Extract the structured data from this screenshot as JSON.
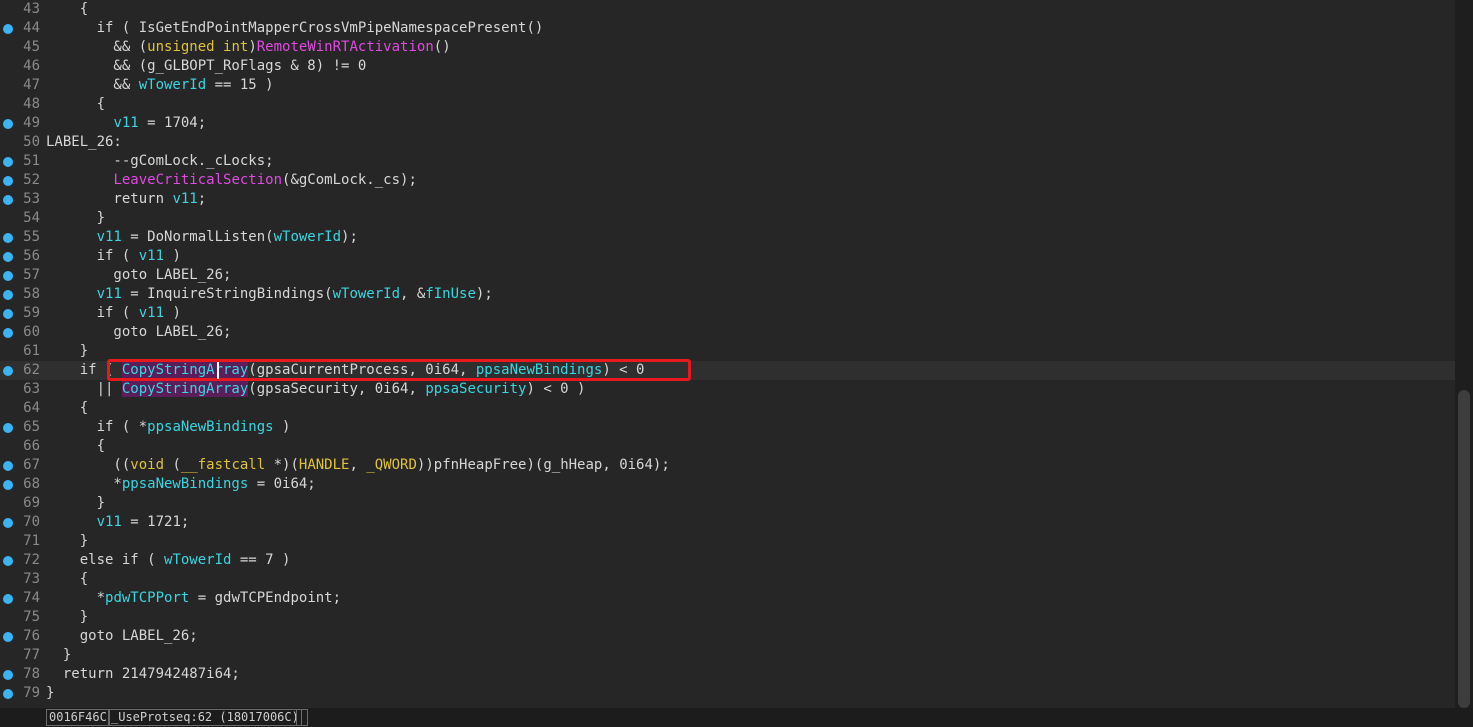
{
  "lines": [
    {
      "n": "43",
      "bp": false,
      "tokens": [
        {
          "t": "    {",
          "c": "plain"
        }
      ]
    },
    {
      "n": "44",
      "bp": true,
      "tokens": [
        {
          "t": "      if ( ",
          "c": "plain"
        },
        {
          "t": "IsGetEndPointMapperCrossVmPipeNamespacePresent",
          "c": "plain"
        },
        {
          "t": "()",
          "c": "plain"
        }
      ]
    },
    {
      "n": "45",
      "bp": false,
      "tokens": [
        {
          "t": "        && (",
          "c": "plain"
        },
        {
          "t": "unsigned int",
          "c": "type"
        },
        {
          "t": ")",
          "c": "plain"
        },
        {
          "t": "RemoteWinRTActivation",
          "c": "func"
        },
        {
          "t": "()",
          "c": "plain"
        }
      ]
    },
    {
      "n": "46",
      "bp": false,
      "tokens": [
        {
          "t": "        && (g_GLBOPT_RoFlags & 8) != 0",
          "c": "plain"
        }
      ]
    },
    {
      "n": "47",
      "bp": false,
      "tokens": [
        {
          "t": "        && ",
          "c": "plain"
        },
        {
          "t": "wTowerId",
          "c": "var"
        },
        {
          "t": " == 15 )",
          "c": "plain"
        }
      ]
    },
    {
      "n": "48",
      "bp": false,
      "tokens": [
        {
          "t": "      {",
          "c": "plain"
        }
      ]
    },
    {
      "n": "49",
      "bp": true,
      "tokens": [
        {
          "t": "        ",
          "c": "plain"
        },
        {
          "t": "v11",
          "c": "var"
        },
        {
          "t": " = 1704;",
          "c": "plain"
        }
      ]
    },
    {
      "n": "50",
      "bp": false,
      "tokens": [
        {
          "t": "LABEL_26:",
          "c": "plain"
        }
      ]
    },
    {
      "n": "51",
      "bp": true,
      "tokens": [
        {
          "t": "        --gComLock._cLocks;",
          "c": "plain"
        }
      ]
    },
    {
      "n": "52",
      "bp": true,
      "tokens": [
        {
          "t": "        ",
          "c": "plain"
        },
        {
          "t": "LeaveCriticalSection",
          "c": "func"
        },
        {
          "t": "(&gComLock._cs);",
          "c": "plain"
        }
      ]
    },
    {
      "n": "53",
      "bp": true,
      "tokens": [
        {
          "t": "        return ",
          "c": "plain"
        },
        {
          "t": "v11",
          "c": "var"
        },
        {
          "t": ";",
          "c": "plain"
        }
      ]
    },
    {
      "n": "54",
      "bp": false,
      "tokens": [
        {
          "t": "      }",
          "c": "plain"
        }
      ]
    },
    {
      "n": "55",
      "bp": true,
      "tokens": [
        {
          "t": "      ",
          "c": "plain"
        },
        {
          "t": "v11",
          "c": "var"
        },
        {
          "t": " = DoNormalListen(",
          "c": "plain"
        },
        {
          "t": "wTowerId",
          "c": "var"
        },
        {
          "t": ");",
          "c": "plain"
        }
      ]
    },
    {
      "n": "56",
      "bp": true,
      "tokens": [
        {
          "t": "      if ( ",
          "c": "plain"
        },
        {
          "t": "v11",
          "c": "var"
        },
        {
          "t": " )",
          "c": "plain"
        }
      ]
    },
    {
      "n": "57",
      "bp": true,
      "tokens": [
        {
          "t": "        goto LABEL_26;",
          "c": "plain"
        }
      ]
    },
    {
      "n": "58",
      "bp": true,
      "tokens": [
        {
          "t": "      ",
          "c": "plain"
        },
        {
          "t": "v11",
          "c": "var"
        },
        {
          "t": " = InquireStringBindings(",
          "c": "plain"
        },
        {
          "t": "wTowerId",
          "c": "var"
        },
        {
          "t": ", &",
          "c": "plain"
        },
        {
          "t": "fInUse",
          "c": "var"
        },
        {
          "t": ");",
          "c": "plain"
        }
      ]
    },
    {
      "n": "59",
      "bp": true,
      "tokens": [
        {
          "t": "      if ( ",
          "c": "plain"
        },
        {
          "t": "v11",
          "c": "var"
        },
        {
          "t": " )",
          "c": "plain"
        }
      ]
    },
    {
      "n": "60",
      "bp": true,
      "tokens": [
        {
          "t": "        goto LABEL_26;",
          "c": "plain"
        }
      ]
    },
    {
      "n": "61",
      "bp": false,
      "tokens": [
        {
          "t": "    }",
          "c": "plain"
        }
      ]
    },
    {
      "n": "62",
      "bp": true,
      "current": true,
      "tokens": [
        {
          "t": "    if ( ",
          "c": "plain"
        },
        {
          "t": "CopyStringArray",
          "c": "hl"
        },
        {
          "t": "(gpsaCurrentProcess, 0i64, ",
          "c": "plain"
        },
        {
          "t": "ppsaNewBindings",
          "c": "var"
        },
        {
          "t": ") < 0",
          "c": "plain"
        }
      ]
    },
    {
      "n": "63",
      "bp": false,
      "tokens": [
        {
          "t": "      || ",
          "c": "plain"
        },
        {
          "t": "CopyStringArray",
          "c": "hl"
        },
        {
          "t": "(gpsaSecurity, 0i64, ",
          "c": "plain"
        },
        {
          "t": "ppsaSecurity",
          "c": "var"
        },
        {
          "t": ") < 0 )",
          "c": "plain"
        }
      ]
    },
    {
      "n": "64",
      "bp": false,
      "tokens": [
        {
          "t": "    {",
          "c": "plain"
        }
      ]
    },
    {
      "n": "65",
      "bp": true,
      "tokens": [
        {
          "t": "      if ( *",
          "c": "plain"
        },
        {
          "t": "ppsaNewBindings",
          "c": "var"
        },
        {
          "t": " )",
          "c": "plain"
        }
      ]
    },
    {
      "n": "66",
      "bp": false,
      "tokens": [
        {
          "t": "      {",
          "c": "plain"
        }
      ]
    },
    {
      "n": "67",
      "bp": true,
      "tokens": [
        {
          "t": "        ((",
          "c": "plain"
        },
        {
          "t": "void",
          "c": "type"
        },
        {
          "t": " (",
          "c": "plain"
        },
        {
          "t": "__fastcall",
          "c": "type"
        },
        {
          "t": " *)(",
          "c": "plain"
        },
        {
          "t": "HANDLE",
          "c": "type"
        },
        {
          "t": ", ",
          "c": "plain"
        },
        {
          "t": "_QWORD",
          "c": "type"
        },
        {
          "t": "))pfnHeapFree)(g_hHeap, 0i64);",
          "c": "plain"
        }
      ]
    },
    {
      "n": "68",
      "bp": true,
      "tokens": [
        {
          "t": "        *",
          "c": "plain"
        },
        {
          "t": "ppsaNewBindings",
          "c": "var"
        },
        {
          "t": " = 0i64;",
          "c": "plain"
        }
      ]
    },
    {
      "n": "69",
      "bp": false,
      "tokens": [
        {
          "t": "      }",
          "c": "plain"
        }
      ]
    },
    {
      "n": "70",
      "bp": true,
      "tokens": [
        {
          "t": "      ",
          "c": "plain"
        },
        {
          "t": "v11",
          "c": "var"
        },
        {
          "t": " = 1721;",
          "c": "plain"
        }
      ]
    },
    {
      "n": "71",
      "bp": false,
      "tokens": [
        {
          "t": "    }",
          "c": "plain"
        }
      ]
    },
    {
      "n": "72",
      "bp": true,
      "tokens": [
        {
          "t": "    else if ( ",
          "c": "plain"
        },
        {
          "t": "wTowerId",
          "c": "var"
        },
        {
          "t": " == 7 )",
          "c": "plain"
        }
      ]
    },
    {
      "n": "73",
      "bp": false,
      "tokens": [
        {
          "t": "    {",
          "c": "plain"
        }
      ]
    },
    {
      "n": "74",
      "bp": true,
      "tokens": [
        {
          "t": "      *",
          "c": "plain"
        },
        {
          "t": "pdwTCPPort",
          "c": "var"
        },
        {
          "t": " = gdwTCPEndpoint;",
          "c": "plain"
        }
      ]
    },
    {
      "n": "75",
      "bp": false,
      "tokens": [
        {
          "t": "    }",
          "c": "plain"
        }
      ]
    },
    {
      "n": "76",
      "bp": true,
      "tokens": [
        {
          "t": "    goto LABEL_26;",
          "c": "plain"
        }
      ]
    },
    {
      "n": "77",
      "bp": false,
      "tokens": [
        {
          "t": "  }",
          "c": "plain"
        }
      ]
    },
    {
      "n": "78",
      "bp": true,
      "tokens": [
        {
          "t": "  return 2147942487i64;",
          "c": "plain"
        }
      ]
    },
    {
      "n": "79",
      "bp": true,
      "tokens": [
        {
          "t": "}",
          "c": "plain"
        }
      ]
    }
  ],
  "status": {
    "address": "0016F46C",
    "location": "_UseProtseq:62 (18017006C)",
    "extra": " "
  },
  "colors": {
    "background": "#262626",
    "variable": "#3ad5e0",
    "function": "#e04ae0",
    "type": "#e0c23a",
    "breakpoint": "#3ab4f2",
    "highlight_box": "#e8191c"
  }
}
